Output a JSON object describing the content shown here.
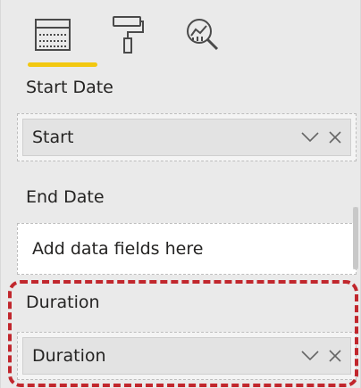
{
  "tabs": [
    {
      "icon": "fields-icon",
      "active": true
    },
    {
      "icon": "format-paint-roller-icon",
      "active": false
    },
    {
      "icon": "analytics-magnifier-icon",
      "active": false
    }
  ],
  "colors": {
    "accent_underline": "#f2c811",
    "highlight": "#c1272d"
  },
  "sections": {
    "start_date": {
      "label": "Start Date",
      "field": "Start"
    },
    "end_date": {
      "label": "End Date",
      "placeholder": "Add data fields here"
    },
    "duration": {
      "label": "Duration",
      "field": "Duration"
    }
  }
}
